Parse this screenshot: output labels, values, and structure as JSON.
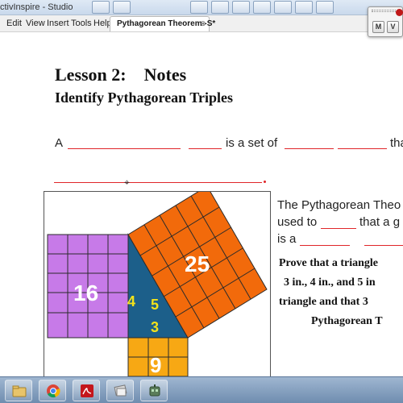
{
  "window": {
    "title": "ctivInspire - Studio"
  },
  "menu": {
    "items": [
      "Edit",
      "View",
      "Insert",
      "Tools",
      "Help"
    ]
  },
  "document_tab": {
    "label": "Pythagorean Theorem -S*",
    "close": "⊗"
  },
  "float_toolbar": {
    "buttons": [
      "M",
      "V"
    ]
  },
  "lesson": {
    "title": "Lesson 2:    Notes",
    "subtitle": "Identify Pythagorean Triples",
    "sentence": {
      "a": "A",
      "middle": "is a set of",
      "end": "tha"
    }
  },
  "figure": {
    "colors": {
      "purple": "#c77ae8",
      "orange": "#f26a0b",
      "yellow": "#f7a814",
      "blue": "#1c5f8a",
      "grid": "#2b2b2b"
    },
    "numbers": {
      "square_large": "25",
      "square_left": "16",
      "square_bottom": "9",
      "side_4": "4",
      "side_5": "5",
      "side_3": "3"
    }
  },
  "right_text": {
    "line1": "The Pythagorean Theo",
    "line2_a": "used to",
    "line2_b": "that a g",
    "line3_a": "is a",
    "prove_lines": [
      "Prove that a triangle",
      "3 in., 4 in., and 5 in",
      "triangle and that 3",
      "Pythagorean T"
    ]
  },
  "taskbar": {
    "apps": [
      "folder-icon",
      "chrome-icon",
      "acrobat-icon",
      "activinspire-icon",
      "robot-icon"
    ]
  }
}
